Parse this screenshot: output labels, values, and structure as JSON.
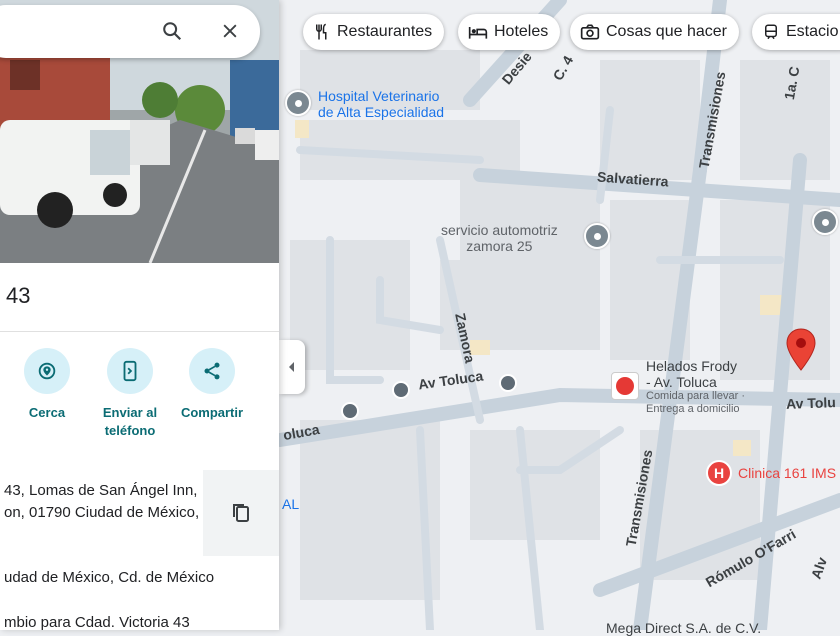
{
  "search": {
    "search_icon": "search-icon",
    "close_icon": "close-icon"
  },
  "place": {
    "title": "43"
  },
  "actions": [
    {
      "label": "Cerca",
      "icon": "nearby-icon"
    },
    {
      "label": "Enviar al",
      "label2": "teléfono",
      "icon": "send-to-phone-icon"
    },
    {
      "label": "Compartir",
      "icon": "share-icon"
    }
  ],
  "address": {
    "line1": "43, Lomas de San Ángel Inn,",
    "line2": "on, 01790 Ciudad de México,"
  },
  "plus_code": "udad de México, Cd. de México",
  "suggest": "mbio para Cdad. Victoria 43",
  "chips": [
    {
      "label": "Restaurantes",
      "icon": "restaurant-icon"
    },
    {
      "label": "Hoteles",
      "icon": "hotel-icon"
    },
    {
      "label": "Cosas que hacer",
      "icon": "camera-icon"
    },
    {
      "label": "Estacio",
      "icon": "transit-icon"
    }
  ],
  "map": {
    "hospital_label_1": "Hospital Veterinario",
    "hospital_label_2": "de Alta Especialidad",
    "servicio_1": "servicio automotriz",
    "servicio_2": "zamora 25",
    "helados_1": "Helados Frody",
    "helados_2": "- Av. Toluca",
    "helados_3": "Comida para llevar ·",
    "helados_4": "Entrega a domicilio",
    "clinica": "Clinica 161 IMS",
    "mega": "Mega Direct S.A. de C.V.",
    "al_fragment": "AL",
    "streets": {
      "salvatierra": "Salvatierra",
      "av_toluca": "Av Toluca",
      "av_toluca_right": "Av Tolu",
      "toluca_left": "oluca",
      "zamora": "Zamora",
      "transmisiones_top": "Transmisiones",
      "transmisiones_bottom": "Transmisiones",
      "desierto": "Desie",
      "c4": "C. 4",
      "la_c": "1a. C",
      "romulo": "Rómulo O'Farri",
      "alv": "Alv"
    }
  },
  "colors": {
    "accent": "#0b6c74",
    "pin": "#ea4335",
    "poi_blue": "#1a73e8",
    "hospital": "#e94340"
  }
}
